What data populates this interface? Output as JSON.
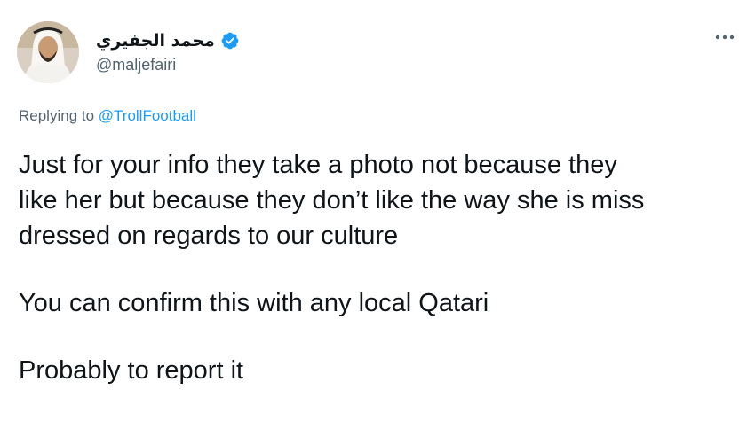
{
  "author": {
    "display_name": "محمد الجفيري",
    "handle": "@maljefairi",
    "verified": true,
    "avatar_icon": "user-avatar-photo"
  },
  "menu": {
    "more_icon": "more-horizontal-icon"
  },
  "reply": {
    "prefix": "Replying to ",
    "mention": "@TrollFootball"
  },
  "tweet": {
    "lines": [
      "Just for your info they take a photo not because they",
      "like her but because they don’t like the way she is miss",
      "dressed on regards to our culture",
      "You can confirm this with any local Qatari",
      "Probably to report it"
    ]
  },
  "colors": {
    "text": "#0f1419",
    "secondary": "#536471",
    "accent": "#1d9bf0"
  }
}
